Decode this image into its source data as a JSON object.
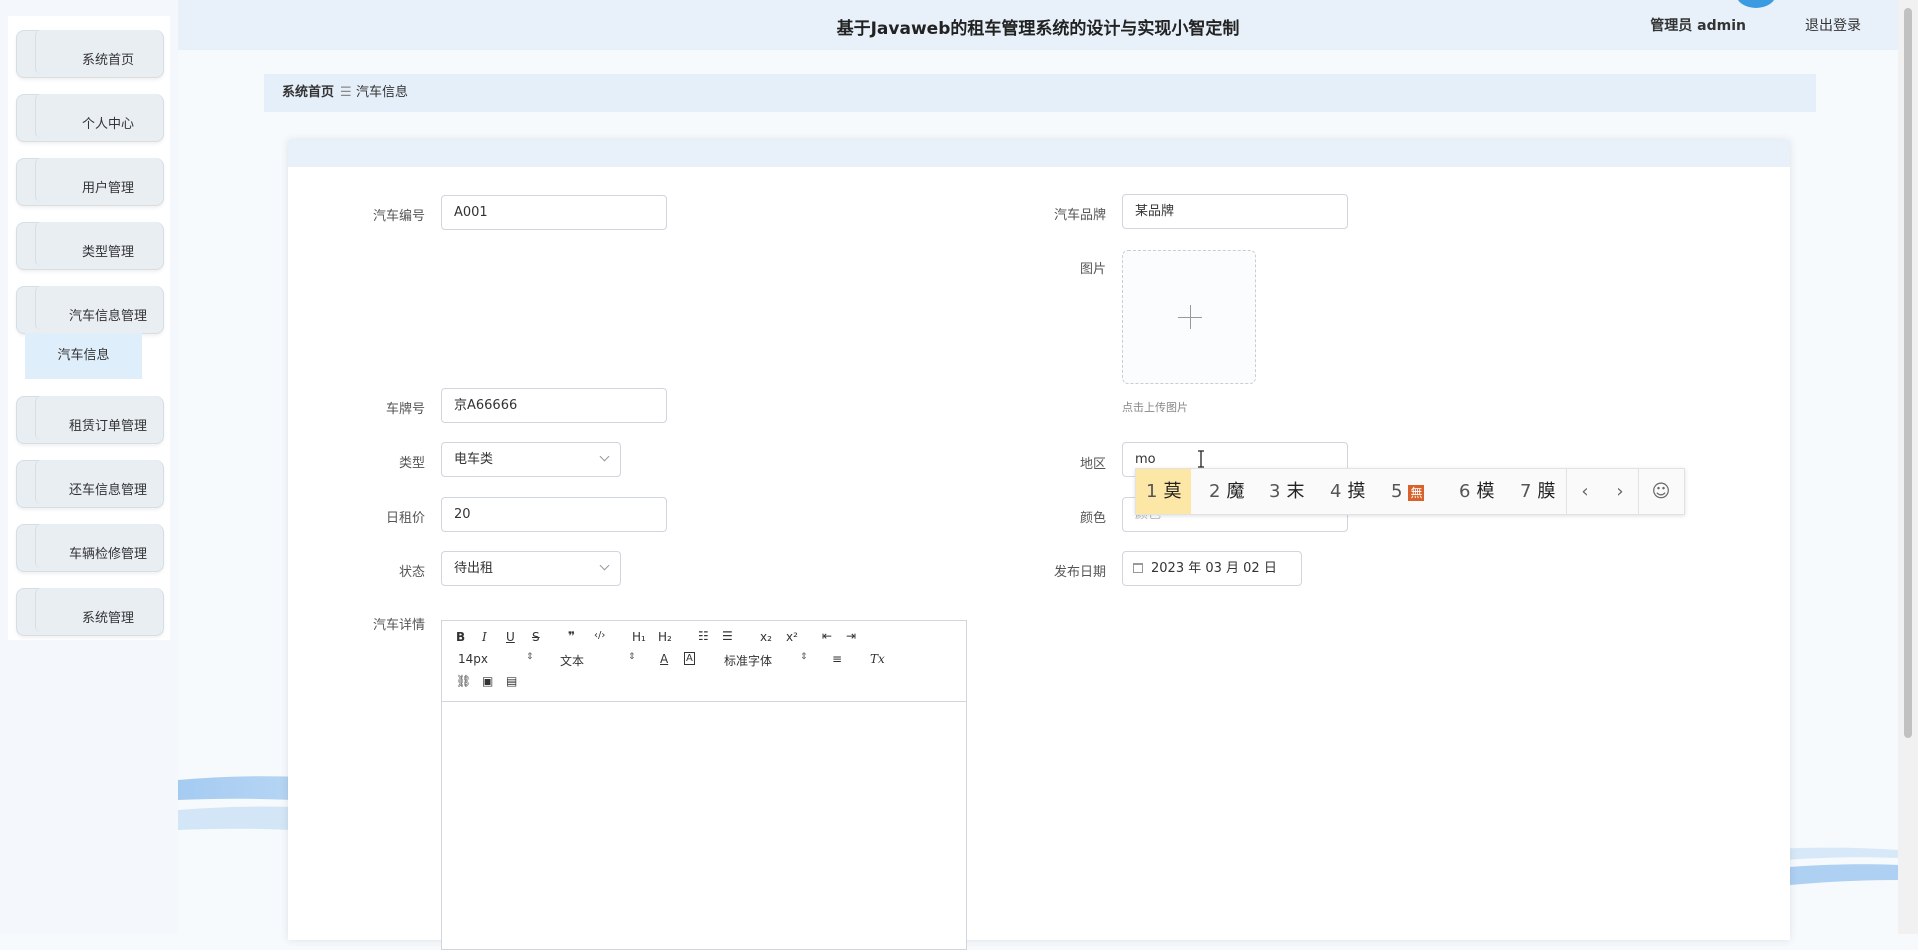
{
  "header": {
    "title": "基于Javaweb的租车管理系统的设计与实现小智定制",
    "user": "管理员 admin",
    "logout": "退出登录"
  },
  "sidebar": {
    "items": [
      {
        "label": "系统首页"
      },
      {
        "label": "个人中心"
      },
      {
        "label": "用户管理"
      },
      {
        "label": "类型管理"
      },
      {
        "label": "汽车信息管理"
      },
      {
        "label": "租赁订单管理"
      },
      {
        "label": "还车信息管理"
      },
      {
        "label": "车辆检修管理"
      },
      {
        "label": "系统管理"
      }
    ],
    "sub_item": "汽车信息"
  },
  "breadcrumb": {
    "home": "系统首页",
    "separator": "☰",
    "current": "汽车信息"
  },
  "form": {
    "car_no": {
      "label": "汽车编号",
      "value": "A001"
    },
    "brand": {
      "label": "汽车品牌",
      "value": "某品牌"
    },
    "image": {
      "label": "图片",
      "tip": "点击上传图片"
    },
    "plate": {
      "label": "车牌号",
      "value": "京A66666"
    },
    "type": {
      "label": "类型",
      "value": "电车类"
    },
    "region": {
      "label": "地区",
      "value": "mo"
    },
    "price": {
      "label": "日租价",
      "value": "20"
    },
    "color": {
      "label": "颜色",
      "placeholder": "颜色"
    },
    "status": {
      "label": "状态",
      "value": "待出租"
    },
    "publish_date": {
      "label": "发布日期",
      "value": "2023 年 03 月 02 日"
    },
    "details": {
      "label": "汽车详情"
    }
  },
  "editor_toolbar": {
    "bold": "B",
    "italic": "I",
    "underline": "U",
    "strike": "S",
    "quote": "❞",
    "code": "‹/›",
    "h1": "H₁",
    "h2": "H₂",
    "ordered": "☷",
    "bullet": "☰",
    "sub": "x₂",
    "sup": "x²",
    "outdent": "⇤",
    "indent": "⇥",
    "size": "14px",
    "header": "文本",
    "font": "标准字体",
    "color": "A",
    "bg": "A",
    "align": "≡",
    "clean": "Tx",
    "link": "⛓",
    "image": "▣",
    "video": "▤"
  },
  "ime": {
    "candidates": [
      {
        "n": "1",
        "ch": "莫"
      },
      {
        "n": "2",
        "ch": "魔"
      },
      {
        "n": "3",
        "ch": "末"
      },
      {
        "n": "4",
        "ch": "摸"
      },
      {
        "n": "5",
        "ch": "無"
      },
      {
        "n": "6",
        "ch": "模"
      },
      {
        "n": "7",
        "ch": "膜"
      }
    ],
    "prev": "‹",
    "next": "›",
    "emoji": "☺"
  },
  "colors": {
    "accent": "#3b9be0",
    "header_bg": "#e8f1fa",
    "ime_highlight": "#fde7a6"
  }
}
